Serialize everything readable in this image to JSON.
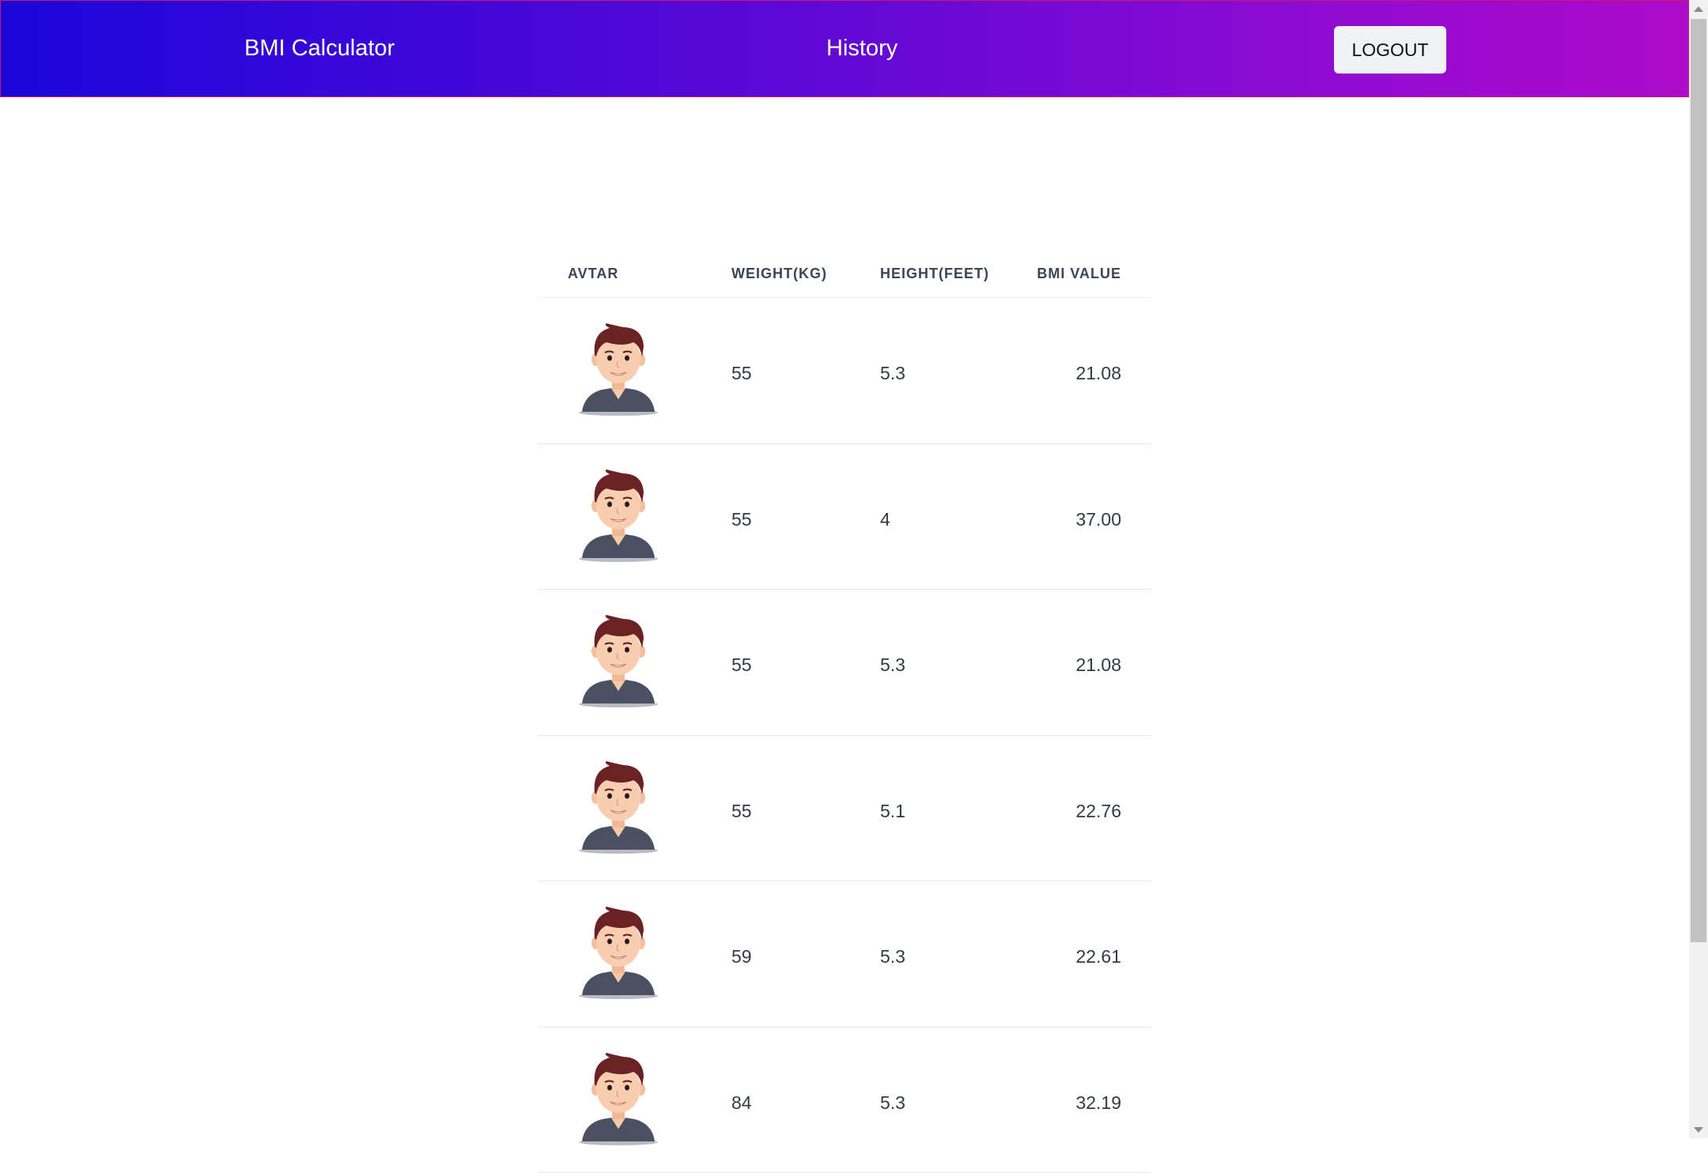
{
  "header": {
    "brand": "BMI Calculator",
    "history_link": "History",
    "logout_label": "LOGOUT"
  },
  "table": {
    "columns": [
      "AVTAR",
      "WEIGHT(KG)",
      "HEIGHT(FEET)",
      "BMI VALUE"
    ],
    "rows": [
      {
        "avatar": "male-avatar",
        "weight": "55",
        "height": "5.3",
        "bmi": "21.08"
      },
      {
        "avatar": "male-avatar",
        "weight": "55",
        "height": "4",
        "bmi": "37.00"
      },
      {
        "avatar": "male-avatar",
        "weight": "55",
        "height": "5.3",
        "bmi": "21.08"
      },
      {
        "avatar": "male-avatar",
        "weight": "55",
        "height": "5.1",
        "bmi": "22.76"
      },
      {
        "avatar": "male-avatar",
        "weight": "59",
        "height": "5.3",
        "bmi": "22.61"
      },
      {
        "avatar": "male-avatar",
        "weight": "84",
        "height": "5.3",
        "bmi": "32.19"
      }
    ]
  },
  "colors": {
    "header_gradient_start": "#1b06da",
    "header_gradient_end": "#ae0bca",
    "logout_bg": "#f0f2f5",
    "header_text": "#3c4556"
  }
}
